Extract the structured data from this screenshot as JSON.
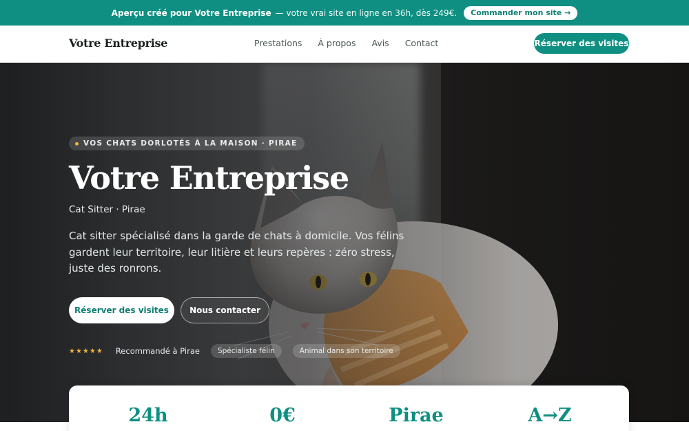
{
  "promo": {
    "brand": "Aperçu créé pour Votre Entreprise",
    "text": "— votre vrai site en ligne en 36h, dès 249€.",
    "button": "Commander mon site →"
  },
  "nav": {
    "logo": "Votre Entreprise",
    "links": [
      "Prestations",
      "À propos",
      "Avis",
      "Contact"
    ],
    "cta": "Réserver des visites"
  },
  "hero": {
    "eyebrow": "VOS CHATS DORLOTÉS À LA MAISON · PIRAE",
    "title": "Votre Entreprise",
    "subtitle": "Cat Sitter · Pirae",
    "description": "Cat sitter spécialisé dans la garde de chats à domicile. Vos félins gardent leur territoire, leur litière et leurs repères : zéro stress, juste des ronrons.",
    "primary_button": "Réserver des visites",
    "secondary_button": "Nous contacter",
    "stars": "★★★★★",
    "recommendation": "Recommandé à Pirae",
    "chips": [
      "Spécialiste félin",
      "Animal dans son territoire"
    ]
  },
  "stats": [
    "24h",
    "0€",
    "Pirae",
    "A→Z"
  ],
  "colors": {
    "accent": "#0f8f82",
    "star": "#f0b43a"
  }
}
